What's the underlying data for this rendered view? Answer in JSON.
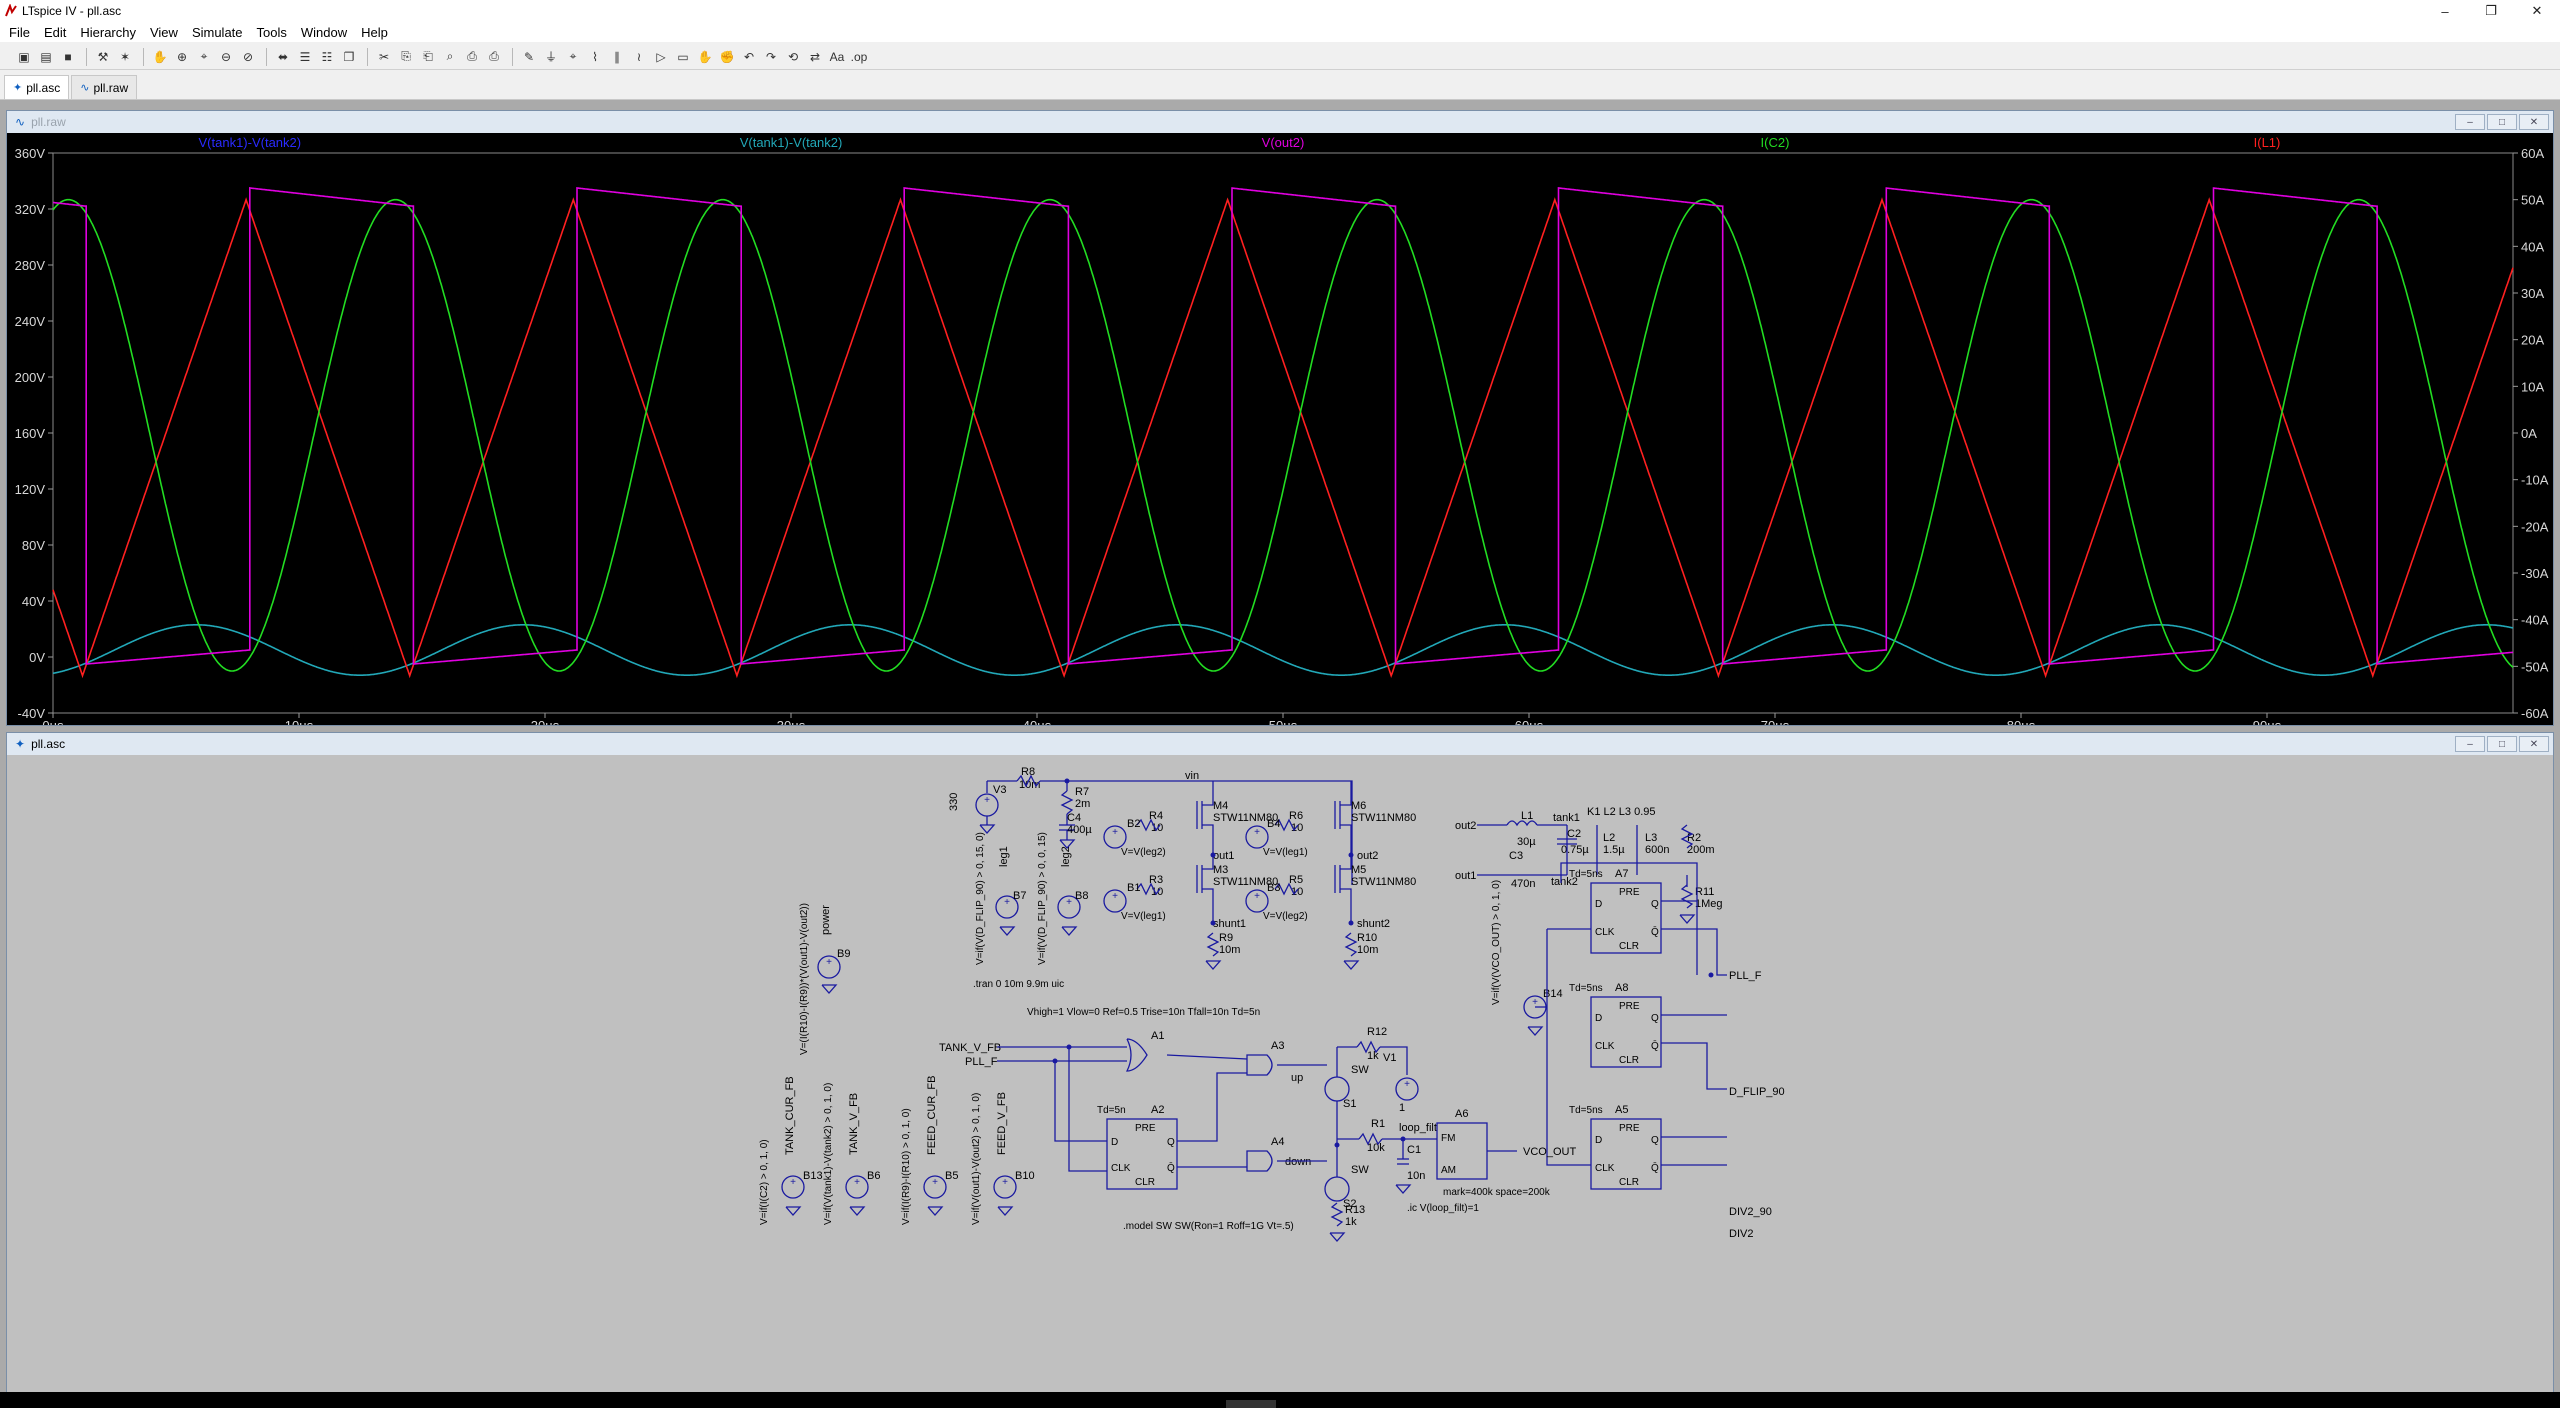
{
  "window": {
    "title": "LTspice IV - pll.asc",
    "controls": {
      "minimize": "–",
      "restore": "❐",
      "close": "✕"
    }
  },
  "menu": [
    "File",
    "Edit",
    "Hierarchy",
    "View",
    "Simulate",
    "Tools",
    "Window",
    "Help"
  ],
  "toolbar_icons": [
    "new-schematic-icon",
    "open-icon",
    "save-icon",
    "control-panel-icon",
    "run-icon",
    "halt-icon",
    "zoom-in-icon",
    "pan-icon",
    "zoom-out-icon",
    "zoom-fit-icon",
    "autorange-icon",
    "tile-horizontal-icon",
    "tile-vertical-icon",
    "cascade-icon",
    "cut-icon",
    "copy-icon",
    "paste-icon",
    "find-icon",
    "print-preview-icon",
    "print-icon",
    "wire-icon",
    "ground-icon",
    "label-icon",
    "resistor-icon",
    "capacitor-icon",
    "inductor-icon",
    "diode-icon",
    "component-icon",
    "move-icon",
    "drag-icon",
    "undo-icon",
    "redo-icon",
    "rotate-icon",
    "mirror-icon",
    "text-icon",
    "spice-directive-icon"
  ],
  "tabs": [
    {
      "label": "pll.asc",
      "icon": "schematic-icon"
    },
    {
      "label": "pll.raw",
      "icon": "waveform-icon"
    }
  ],
  "waveform_window": {
    "title": "pll.raw"
  },
  "schematic_window": {
    "title": "pll.asc"
  },
  "colors": {
    "trace_blue": "#2a2aff",
    "trace_cyan": "#22a8b8",
    "trace_magenta": "#e000e0",
    "trace_green": "#22dd22",
    "trace_red": "#ff2020",
    "plot_bg": "#000000",
    "schematic_bg": "#c0c0c0",
    "schematic_wire": "#1a1aa0"
  },
  "chart_data": {
    "type": "line",
    "title": "",
    "x": {
      "ticks": [
        "0µs",
        "10µs",
        "20µs",
        "30µs",
        "40µs",
        "50µs",
        "60µs",
        "70µs",
        "80µs",
        "90µs"
      ],
      "range": [
        0,
        100
      ],
      "unit": "µs"
    },
    "y_left": {
      "ticks": [
        "360V",
        "320V",
        "280V",
        "240V",
        "200V",
        "160V",
        "120V",
        "80V",
        "40V",
        "0V",
        "-40V"
      ],
      "range": [
        -40,
        360
      ]
    },
    "y_right": {
      "ticks": [
        "60A",
        "50A",
        "40A",
        "30A",
        "20A",
        "10A",
        "0A",
        "-10A",
        "-20A",
        "-30A",
        "-40A",
        "-50A",
        "-60A"
      ],
      "range": [
        -60,
        60
      ]
    },
    "grid": false,
    "series": [
      {
        "name": "V(tank1)-V(tank2)",
        "color": "#2a2aff",
        "axis": "left",
        "shape": "hidden-under-cyan",
        "period_us": 13.3
      },
      {
        "name": "V(tank1)-V(tank2)",
        "color": "#22a8b8",
        "axis": "left",
        "shape": "sine",
        "period_us": 13.3,
        "min": -18,
        "max": 18,
        "offset": 5,
        "phase_us": 2.5
      },
      {
        "name": "V(out2)",
        "color": "#e000e0",
        "axis": "left",
        "shape": "square-droop",
        "period_us": 13.3,
        "high_start": 335,
        "high_end": 322,
        "low_start": -5,
        "low_end": 5,
        "duty": 0.5,
        "phase_us": 8.0
      },
      {
        "name": "I(C2)",
        "color": "#22dd22",
        "axis": "right",
        "shape": "sine",
        "period_us": 13.3,
        "min": -51,
        "max": 50,
        "phase_us": 10.6
      },
      {
        "name": "I(L1)",
        "color": "#ff2020",
        "axis": "right",
        "shape": "triangle",
        "period_us": 13.3,
        "min": -52,
        "max": 50,
        "phase_us": 14.5
      }
    ]
  },
  "schematic": {
    "labels": [
      "R8",
      "10m",
      "V3",
      "330",
      "vin",
      "R7",
      "2m",
      "C4",
      "400µ",
      "R4",
      "10",
      "M4",
      "STW11NM80",
      "R6",
      "10",
      "M6",
      "STW11NM80",
      "B2",
      "V=V(leg2)",
      "B4",
      "V=V(leg1)",
      "out1",
      "out2",
      "R3",
      "10",
      "M3",
      "STW11NM80",
      "R5",
      "10",
      "M5",
      "STW11NM80",
      "B1",
      "V=V(leg1)",
      "B3",
      "V=V(leg2)",
      "shunt1",
      "shunt2",
      "R9",
      "10m",
      "R10",
      "10m",
      "B7",
      "leg1",
      "B8",
      "leg2",
      "V=if(V(D_FLIP_90) > 0, 15, 0)",
      "V=if(V(D_FLIP_90) > 0, 0, 15)",
      ".tran 0 10m 9.9m uic",
      "B9",
      "power",
      "V=(I(R10)-I(R9))*(V(out1)-V(out2))",
      "K1 L2 L3 0.95",
      "out2",
      "L1",
      "30µ",
      "tank1",
      "C2",
      "0.75µ",
      "L2",
      "1.5µ",
      "L3",
      "600n",
      "R2",
      "200m",
      "out1",
      "C3",
      "470n",
      "tank2",
      "R11",
      "1Meg",
      "V=if(V(VCO_OUT) > 0, 1, 0)",
      "B14",
      "Td=5ns",
      "A7",
      "PRE",
      "D",
      "Q",
      "CLK",
      "Q̄",
      "CLR",
      "PLL_F",
      "Td=5ns",
      "A8",
      "PRE",
      "D",
      "Q",
      "CLK",
      "Q̄",
      "CLR",
      "D_FLIP_90",
      "Td=5ns",
      "A5",
      "PRE",
      "D",
      "Q",
      "CLK",
      "Q̄",
      "CLR",
      "DIV2_90",
      "DIV2",
      "Vhigh=1 Vlow=0 Ref=0.5 Trise=10n Tfall=10n Td=5n",
      "TANK_V_FB",
      "PLL_F",
      "A1",
      "A3",
      "A2",
      "Td=5n",
      "PRE",
      "D",
      "Q",
      "CLK",
      "Q̄",
      "CLR",
      "A4",
      "up",
      "down",
      "SW",
      "S1",
      "SW",
      "S2",
      "R12",
      "1k",
      "V1",
      "1",
      "R1",
      "10k",
      "loop_filt",
      "C1",
      "10n",
      "R13",
      "1k",
      "A6",
      "FM",
      "AM",
      "VCO_OUT",
      "mark=400k space=200k",
      ".ic V(loop_filt)=1",
      ".model SW SW(Ron=1 Roff=1G Vt=.5)",
      "V=if(I(C2) > 0, 1, 0)",
      "B13",
      "TANK_CUR_FB",
      "V=if(V(tank1)-V(tank2) > 0, 1, 0)",
      "B6",
      "TANK_V_FB",
      "V=if(I(R9)-I(R10) > 0, 1, 0)",
      "B5",
      "FEED_CUR_FB",
      "V=if(V(out1)-V(out2) > 0, 1, 0)",
      "B10",
      "FEED_V_FB"
    ]
  }
}
